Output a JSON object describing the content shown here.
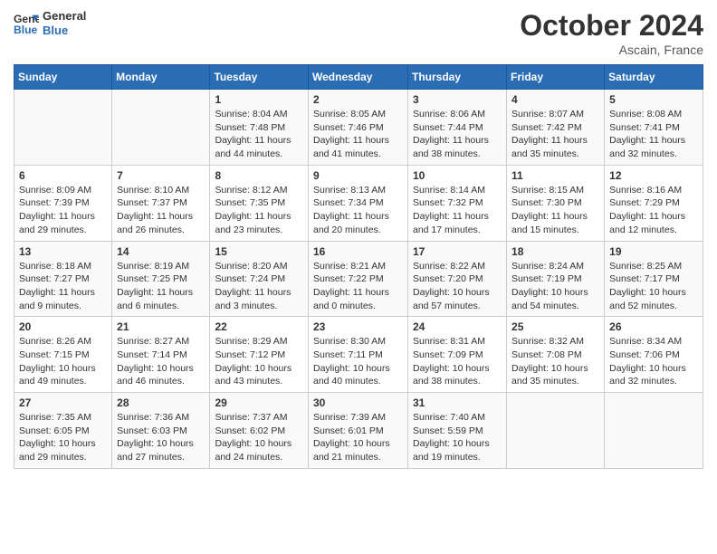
{
  "logo": {
    "text_general": "General",
    "text_blue": "Blue"
  },
  "header": {
    "month": "October 2024",
    "location": "Ascain, France"
  },
  "weekdays": [
    "Sunday",
    "Monday",
    "Tuesday",
    "Wednesday",
    "Thursday",
    "Friday",
    "Saturday"
  ],
  "weeks": [
    [
      {
        "day": "",
        "info": ""
      },
      {
        "day": "",
        "info": ""
      },
      {
        "day": "1",
        "info": "Sunrise: 8:04 AM\nSunset: 7:48 PM\nDaylight: 11 hours and 44 minutes."
      },
      {
        "day": "2",
        "info": "Sunrise: 8:05 AM\nSunset: 7:46 PM\nDaylight: 11 hours and 41 minutes."
      },
      {
        "day": "3",
        "info": "Sunrise: 8:06 AM\nSunset: 7:44 PM\nDaylight: 11 hours and 38 minutes."
      },
      {
        "day": "4",
        "info": "Sunrise: 8:07 AM\nSunset: 7:42 PM\nDaylight: 11 hours and 35 minutes."
      },
      {
        "day": "5",
        "info": "Sunrise: 8:08 AM\nSunset: 7:41 PM\nDaylight: 11 hours and 32 minutes."
      }
    ],
    [
      {
        "day": "6",
        "info": "Sunrise: 8:09 AM\nSunset: 7:39 PM\nDaylight: 11 hours and 29 minutes."
      },
      {
        "day": "7",
        "info": "Sunrise: 8:10 AM\nSunset: 7:37 PM\nDaylight: 11 hours and 26 minutes."
      },
      {
        "day": "8",
        "info": "Sunrise: 8:12 AM\nSunset: 7:35 PM\nDaylight: 11 hours and 23 minutes."
      },
      {
        "day": "9",
        "info": "Sunrise: 8:13 AM\nSunset: 7:34 PM\nDaylight: 11 hours and 20 minutes."
      },
      {
        "day": "10",
        "info": "Sunrise: 8:14 AM\nSunset: 7:32 PM\nDaylight: 11 hours and 17 minutes."
      },
      {
        "day": "11",
        "info": "Sunrise: 8:15 AM\nSunset: 7:30 PM\nDaylight: 11 hours and 15 minutes."
      },
      {
        "day": "12",
        "info": "Sunrise: 8:16 AM\nSunset: 7:29 PM\nDaylight: 11 hours and 12 minutes."
      }
    ],
    [
      {
        "day": "13",
        "info": "Sunrise: 8:18 AM\nSunset: 7:27 PM\nDaylight: 11 hours and 9 minutes."
      },
      {
        "day": "14",
        "info": "Sunrise: 8:19 AM\nSunset: 7:25 PM\nDaylight: 11 hours and 6 minutes."
      },
      {
        "day": "15",
        "info": "Sunrise: 8:20 AM\nSunset: 7:24 PM\nDaylight: 11 hours and 3 minutes."
      },
      {
        "day": "16",
        "info": "Sunrise: 8:21 AM\nSunset: 7:22 PM\nDaylight: 11 hours and 0 minutes."
      },
      {
        "day": "17",
        "info": "Sunrise: 8:22 AM\nSunset: 7:20 PM\nDaylight: 10 hours and 57 minutes."
      },
      {
        "day": "18",
        "info": "Sunrise: 8:24 AM\nSunset: 7:19 PM\nDaylight: 10 hours and 54 minutes."
      },
      {
        "day": "19",
        "info": "Sunrise: 8:25 AM\nSunset: 7:17 PM\nDaylight: 10 hours and 52 minutes."
      }
    ],
    [
      {
        "day": "20",
        "info": "Sunrise: 8:26 AM\nSunset: 7:15 PM\nDaylight: 10 hours and 49 minutes."
      },
      {
        "day": "21",
        "info": "Sunrise: 8:27 AM\nSunset: 7:14 PM\nDaylight: 10 hours and 46 minutes."
      },
      {
        "day": "22",
        "info": "Sunrise: 8:29 AM\nSunset: 7:12 PM\nDaylight: 10 hours and 43 minutes."
      },
      {
        "day": "23",
        "info": "Sunrise: 8:30 AM\nSunset: 7:11 PM\nDaylight: 10 hours and 40 minutes."
      },
      {
        "day": "24",
        "info": "Sunrise: 8:31 AM\nSunset: 7:09 PM\nDaylight: 10 hours and 38 minutes."
      },
      {
        "day": "25",
        "info": "Sunrise: 8:32 AM\nSunset: 7:08 PM\nDaylight: 10 hours and 35 minutes."
      },
      {
        "day": "26",
        "info": "Sunrise: 8:34 AM\nSunset: 7:06 PM\nDaylight: 10 hours and 32 minutes."
      }
    ],
    [
      {
        "day": "27",
        "info": "Sunrise: 7:35 AM\nSunset: 6:05 PM\nDaylight: 10 hours and 29 minutes."
      },
      {
        "day": "28",
        "info": "Sunrise: 7:36 AM\nSunset: 6:03 PM\nDaylight: 10 hours and 27 minutes."
      },
      {
        "day": "29",
        "info": "Sunrise: 7:37 AM\nSunset: 6:02 PM\nDaylight: 10 hours and 24 minutes."
      },
      {
        "day": "30",
        "info": "Sunrise: 7:39 AM\nSunset: 6:01 PM\nDaylight: 10 hours and 21 minutes."
      },
      {
        "day": "31",
        "info": "Sunrise: 7:40 AM\nSunset: 5:59 PM\nDaylight: 10 hours and 19 minutes."
      },
      {
        "day": "",
        "info": ""
      },
      {
        "day": "",
        "info": ""
      }
    ]
  ]
}
